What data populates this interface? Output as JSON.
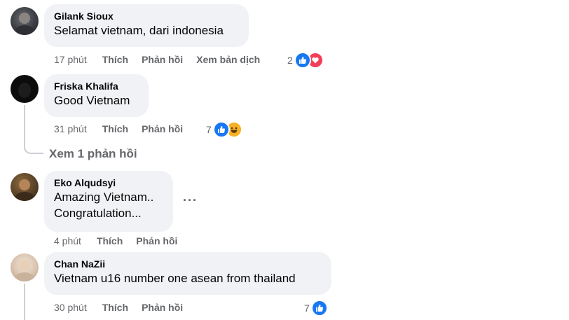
{
  "comments": [
    {
      "name": "Gilank Sioux",
      "lines": [
        "Selamat vietnam, dari indonesia"
      ],
      "time": "17 phút",
      "like_label": "Thích",
      "reply_label": "Phản hồi",
      "translate_label": "Xem bản dịch",
      "reaction_count": "2",
      "reactions": [
        "like-icon",
        "love-icon"
      ]
    },
    {
      "name": "Friska Khalifa",
      "lines": [
        "Good Vietnam"
      ],
      "time": "31 phút",
      "like_label": "Thích",
      "reply_label": "Phản hồi",
      "reaction_count": "7",
      "reactions": [
        "like-icon",
        "haha-icon"
      ],
      "view_replies": "Xem 1 phản hồi"
    },
    {
      "name": "Eko Alqudsyi",
      "lines": [
        "Amazing Vietnam..",
        "Congratulation..."
      ],
      "time": "4 phút",
      "like_label": "Thích",
      "reply_label": "Phản hồi",
      "more_options": "···"
    },
    {
      "name": "Chan NaZii",
      "lines": [
        "Vietnam u16 number one asean from thailand"
      ],
      "time": "30 phút",
      "like_label": "Thích",
      "reply_label": "Phản hồi",
      "reaction_count": "7",
      "reactions": [
        "like-icon"
      ]
    }
  ],
  "colors": {
    "bubble": "#f0f2f5",
    "secondary_text": "#65676b",
    "like_blue": "#1877f2",
    "love_red": "#f33e58",
    "haha_yellow": "#f7b125"
  }
}
